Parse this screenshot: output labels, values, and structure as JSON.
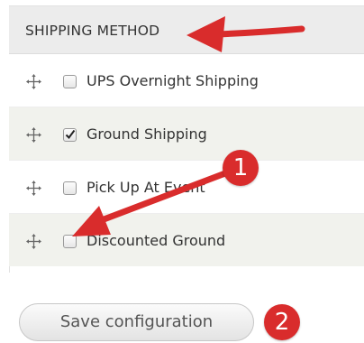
{
  "table": {
    "header": "SHIPPING METHOD",
    "rows": [
      {
        "label": "UPS Overnight Shipping",
        "checked": false
      },
      {
        "label": "Ground Shipping",
        "checked": true
      },
      {
        "label": "Pick Up At Event",
        "checked": false
      },
      {
        "label": "Discounted Ground",
        "checked": false
      }
    ]
  },
  "actions": {
    "save_label": "Save configuration"
  },
  "annotations": {
    "badge_1": "1",
    "badge_2": "2",
    "arrow_color": "#d92c2c"
  },
  "icons": {
    "drag_handle": "move-arrows-icon",
    "checkmark": "checkmark-icon"
  }
}
